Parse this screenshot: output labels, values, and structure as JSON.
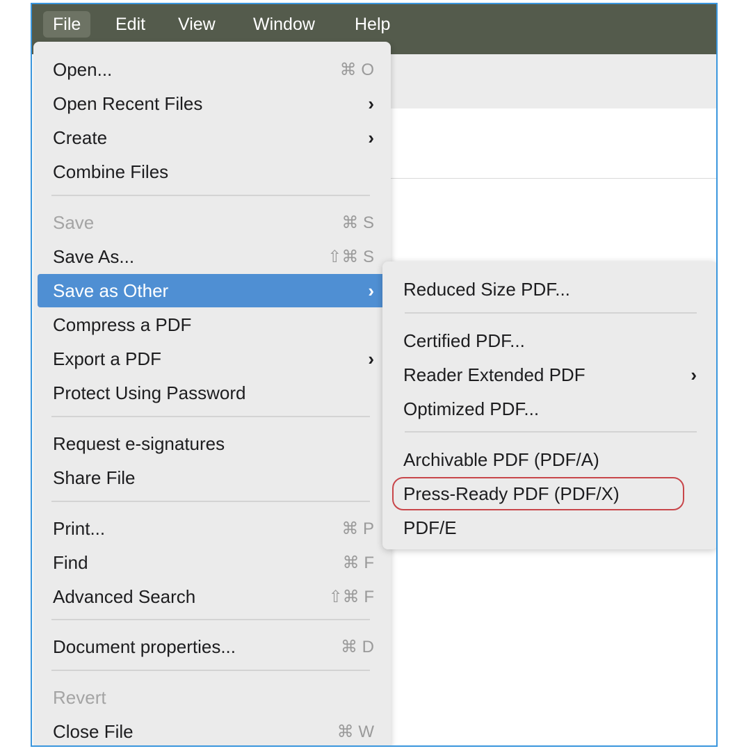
{
  "menubar": {
    "items": [
      {
        "label": "File",
        "active": true
      },
      {
        "label": "Edit"
      },
      {
        "label": "View"
      },
      {
        "label": "Window"
      },
      {
        "label": "Help"
      }
    ]
  },
  "file_menu": {
    "items": [
      {
        "label": "Open...",
        "shortcut": "⌘ O"
      },
      {
        "label": "Open Recent Files",
        "submenu": true
      },
      {
        "label": "Create",
        "submenu": true
      },
      {
        "label": "Combine Files"
      },
      {
        "label": "Save",
        "shortcut": "⌘ S",
        "disabled": true
      },
      {
        "label": "Save As...",
        "shortcut": "⇧⌘ S"
      },
      {
        "label": "Save as Other",
        "submenu": true,
        "highlighted": true
      },
      {
        "label": "Compress a PDF"
      },
      {
        "label": "Export a PDF",
        "submenu": true
      },
      {
        "label": "Protect Using Password"
      },
      {
        "label": "Request e-signatures"
      },
      {
        "label": "Share File"
      },
      {
        "label": "Print...",
        "shortcut": "⌘ P"
      },
      {
        "label": "Find",
        "shortcut": "⌘ F"
      },
      {
        "label": "Advanced Search",
        "shortcut": "⇧⌘ F"
      },
      {
        "label": "Document properties...",
        "shortcut": "⌘ D"
      },
      {
        "label": "Revert",
        "disabled": true
      },
      {
        "label": "Close File",
        "shortcut": "⌘ W"
      }
    ],
    "chevron": "›"
  },
  "save_as_other_submenu": {
    "items": [
      {
        "label": "Reduced Size PDF..."
      },
      {
        "label": "Certified PDF..."
      },
      {
        "label": "Reader Extended PDF",
        "submenu": true
      },
      {
        "label": "Optimized PDF..."
      },
      {
        "label": "Archivable PDF (PDF/A)"
      },
      {
        "label": "Press-Ready PDF (PDF/X)",
        "circled": true
      },
      {
        "label": "PDF/E"
      }
    ],
    "chevron": "›"
  },
  "colors": {
    "menubar_bg": "#545b4c",
    "highlight": "#4f8fd3",
    "annotation_ring": "#c8464a",
    "frame_border": "#3a96dd"
  }
}
